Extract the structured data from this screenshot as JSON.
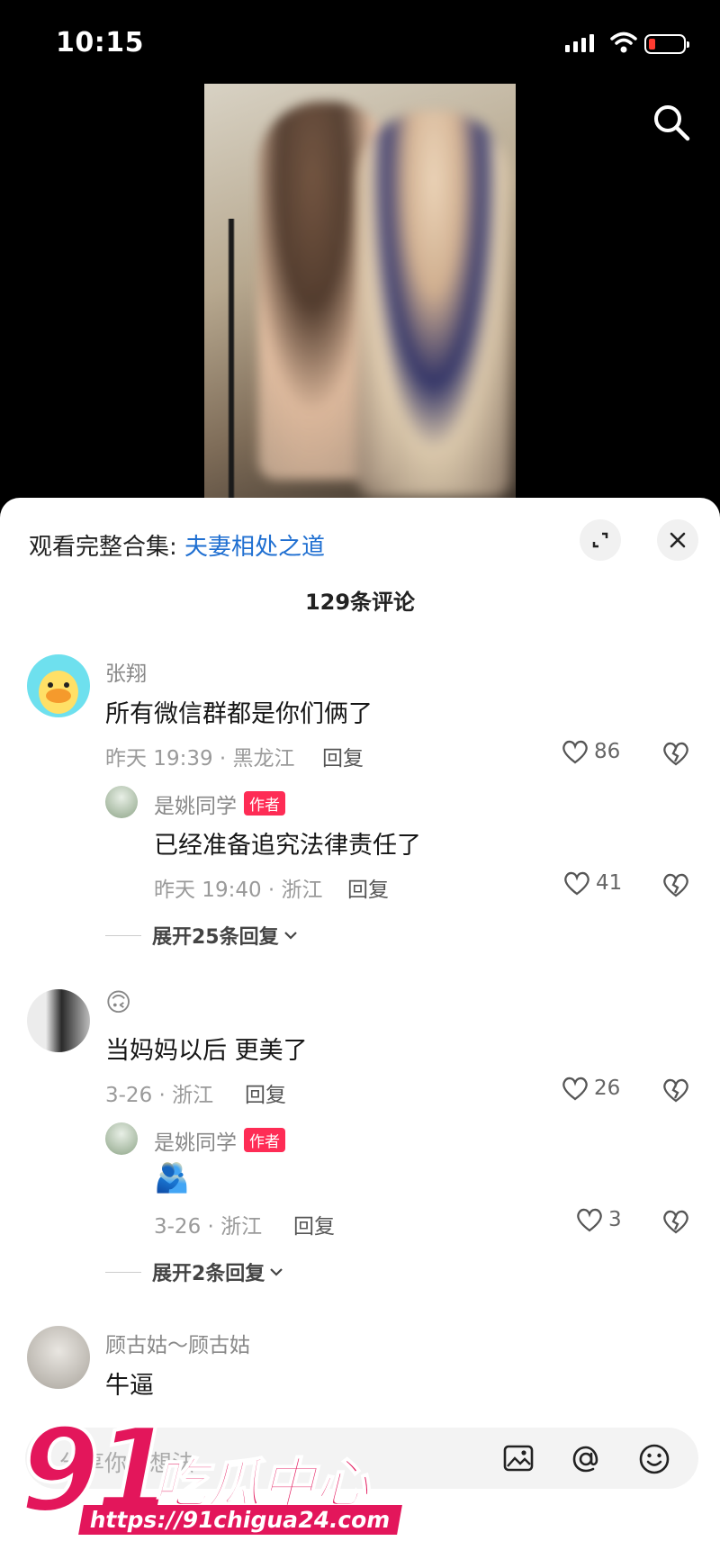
{
  "status": {
    "time": "10:15"
  },
  "sheet": {
    "collection_prefix": "观看完整合集:",
    "collection_name": "夫妻相处之道",
    "comment_count": "129条评论"
  },
  "comments": [
    {
      "user": "张翔",
      "text": "所有微信群都是你们俩了",
      "meta": "昨天 19:39 · 黑龙江",
      "reply_label": "回复",
      "likes": "86",
      "replies": [
        {
          "user": "是姚同学",
          "tag": "作者",
          "text": "已经准备追究法律责任了",
          "meta": "昨天 19:40 · 浙江",
          "reply_label": "回复",
          "likes": "41"
        }
      ],
      "expand": "展开25条回复"
    },
    {
      "user": "🙃",
      "text": "当妈妈以后 更美了",
      "meta": "3-26 · 浙江",
      "reply_label": "回复",
      "likes": "26",
      "replies": [
        {
          "user": "是姚同学",
          "tag": "作者",
          "text": "🫂",
          "meta": "3-26 · 浙江",
          "reply_label": "回复",
          "likes": "3"
        }
      ],
      "expand": "展开2条回复"
    },
    {
      "user": "顾古姑～顾古姑",
      "text": "牛逼"
    }
  ],
  "input": {
    "placeholder": "分享你的想法"
  },
  "watermark": {
    "number": "91",
    "name": "吃瓜中心",
    "url": "https://91chigua24.com"
  },
  "colors": {
    "accent": "#fe2c55",
    "link": "#1f6fd1",
    "watermark": "#e3165b"
  }
}
